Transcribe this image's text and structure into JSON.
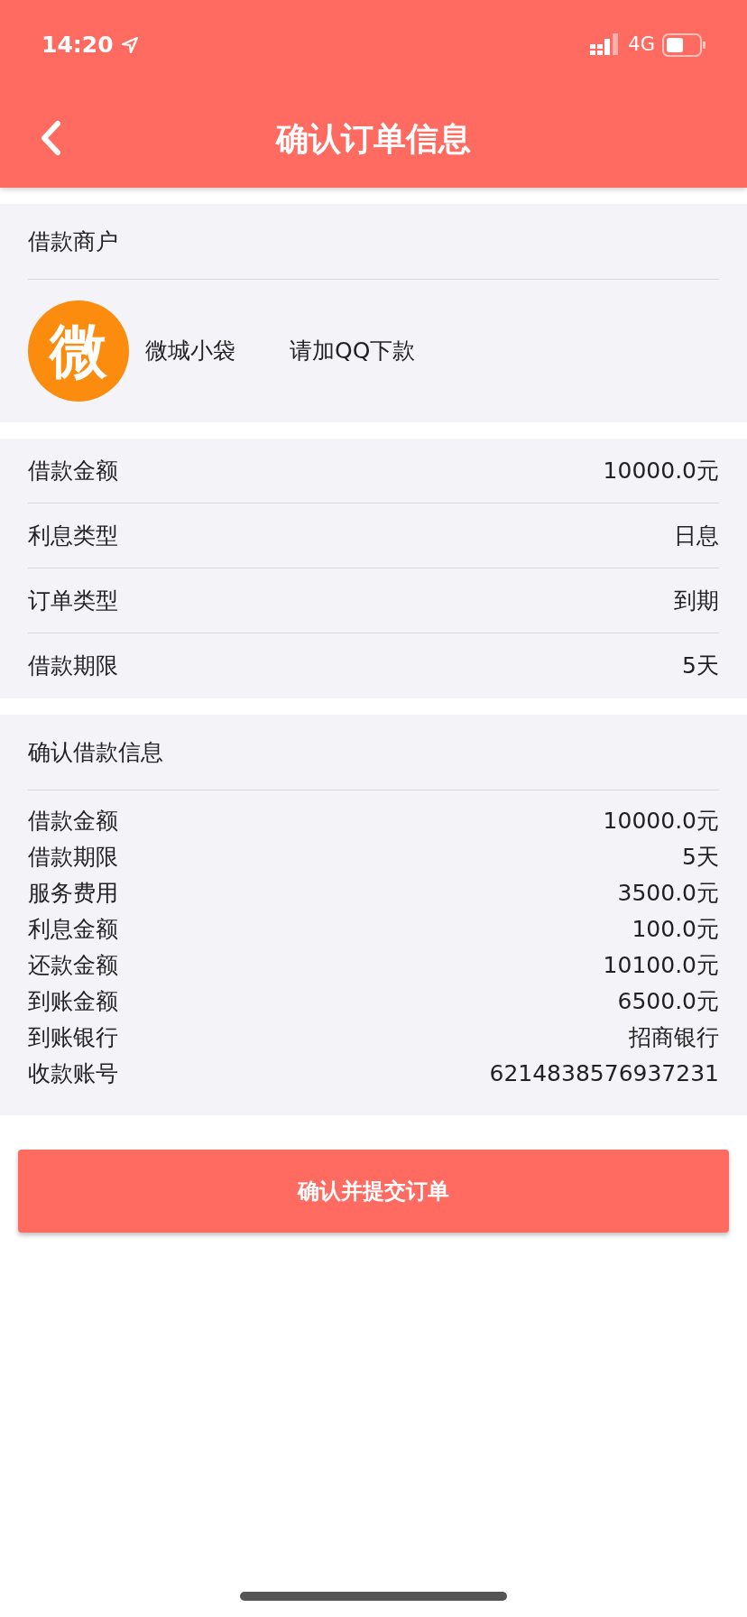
{
  "status_bar": {
    "time": "14:20",
    "network": "4G"
  },
  "nav": {
    "title": "确认订单信息"
  },
  "merchant": {
    "heading": "借款商户",
    "logo_text": "微",
    "name": "微城小袋",
    "note": "请加QQ下款"
  },
  "order": [
    {
      "label": "借款金额",
      "value": "10000.0元"
    },
    {
      "label": "利息类型",
      "value": "日息"
    },
    {
      "label": "订单类型",
      "value": "到期"
    },
    {
      "label": "借款期限",
      "value": "5天"
    }
  ],
  "confirm": {
    "heading": "确认借款信息",
    "rows": [
      {
        "label": "借款金额",
        "value": "10000.0元"
      },
      {
        "label": "借款期限",
        "value": "5天"
      },
      {
        "label": "服务费用",
        "value": "3500.0元"
      },
      {
        "label": "利息金额",
        "value": "100.0元"
      },
      {
        "label": "还款金额",
        "value": "10100.0元"
      },
      {
        "label": "到账金额",
        "value": "6500.0元"
      },
      {
        "label": "到账银行",
        "value": "招商银行"
      },
      {
        "label": "收款账号",
        "value": "6214838576937231"
      }
    ]
  },
  "submit_button": "确认并提交订单"
}
